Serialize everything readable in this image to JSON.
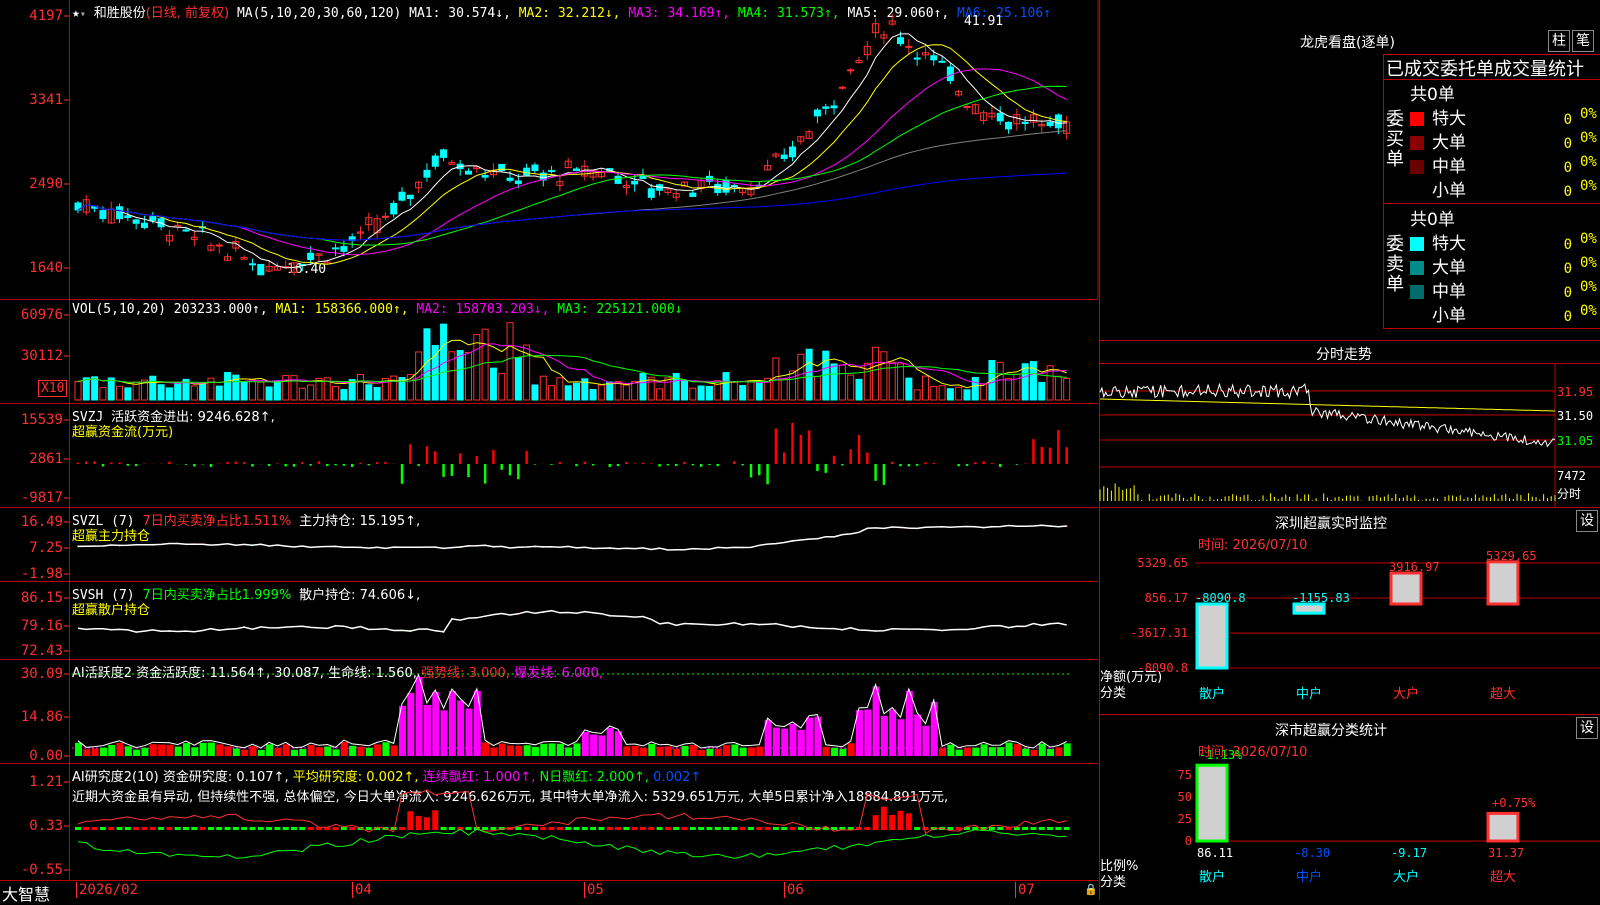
{
  "colors": {
    "up": "#ff3030",
    "down": "#00ffff",
    "grid": "#c00000",
    "ma1": "#ffffff",
    "ma2": "#ffff00",
    "ma3": "#ff00ff",
    "ma4": "#00ff00",
    "ma5": "#808080",
    "ma6": "#0000ff"
  },
  "kline": {
    "stock": "和胜股份",
    "mode": "(日线, 前复权)",
    "ma_header": "MA(5,10,20,30,60,120)",
    "ma1": "MA1: 30.574↓,",
    "ma2": "MA2: 32.212↓,",
    "ma3": "MA3: 34.169↑,",
    "ma4": "MA4: 31.573↑,",
    "ma5": "MA5: 29.060↑,",
    "ma6": "MA6: 25.106↑",
    "high_label": "41.91",
    "low_label": "16.40",
    "y_labels": [
      "4197",
      "3341",
      "2490",
      "1640"
    ]
  },
  "vol": {
    "header": "VOL(5,10,20)",
    "value": "203233.000↑,",
    "ma1": "MA1: 158366.000↑,",
    "ma2": "MA2: 158703.203↓,",
    "ma3": "MA3: 225121.000↓",
    "y_labels": [
      "60976",
      "30112"
    ],
    "unit": "X10"
  },
  "svzj": {
    "header": "SVZJ",
    "value": "活跃资金进出: 9246.628↑,",
    "title": "超赢资金流(万元)",
    "y_labels": [
      "15539",
      "2861",
      "-9817"
    ]
  },
  "svzl": {
    "header": "SVZL (7)",
    "ratio": "7日内买卖净占比1.511%",
    "value": "主力持仓: 15.195↑,",
    "title": "超赢主力持仓",
    "y_labels": [
      "16.49",
      "7.25",
      "-1.98"
    ]
  },
  "svsh": {
    "header": "SVSH (7)",
    "ratio": "7日内买卖净占比1.999%",
    "value": "散户持仓: 74.606↓,",
    "title": "超赢散户持仓",
    "y_labels": [
      "86.15",
      "79.16",
      "72.43"
    ]
  },
  "ai_active": {
    "header": "AI活跃度2",
    "v1": "资金活跃度: 11.564↑, 30.087,",
    "v2": "生命线: 1.560,",
    "v3": "强势线: 3.000,",
    "v4": "爆发线: 6.000,",
    "y_labels": [
      "30.09",
      "14.86",
      "0.00"
    ]
  },
  "ai_research": {
    "header": "AI研究度2(10)",
    "v1": "资金研究度: 0.107↑,",
    "v2": "平均研究度: 0.002↑,",
    "v3": "连续飘红: 1.000↑,",
    "v4": "N日飘红: 2.000↑,",
    "v5": "0.002↑",
    "comment": "近期大资金虽有异动, 但持续性不强, 总体偏空, 今日大单净流入: 9246.626万元, 其中特大单净流入: 5329.651万元, 大单5日累计净入18884.891万元,",
    "y_labels": [
      "1.21",
      "0.33",
      "-0.55"
    ]
  },
  "xaxis": {
    "brand": "大智慧",
    "labels": [
      "2026/02",
      "04",
      "05",
      "06",
      "07"
    ]
  },
  "right_panel": {
    "title": "龙虎看盘(逐单)",
    "btn_bar": "柱",
    "btn_pen": "笔",
    "tabs": [
      "已成交委托单",
      "成交量统计"
    ],
    "buy_label": "委买单",
    "sell_label": "委卖单",
    "buy_total": "共0单",
    "sell_total": "共0单",
    "rows": [
      {
        "name": "特大",
        "count": "0",
        "pct": "0%"
      },
      {
        "name": "大单",
        "count": "0",
        "pct": "0%"
      },
      {
        "name": "中单",
        "count": "0",
        "pct": "0%"
      },
      {
        "name": "小单",
        "count": "0",
        "pct": "0%"
      }
    ],
    "timeshare_title": "分时走势",
    "ts_labels": [
      "31.95",
      "31.50",
      "31.05"
    ],
    "ts_vol": "7472",
    "ts_unit": "分时",
    "monitor_title": "深圳超赢实时监控",
    "monitor_btn": "设",
    "monitor_time": "时间: 2026/07/10",
    "monitor_y": [
      "5329.65",
      "856.17",
      "-3617.31",
      "-8090.8"
    ],
    "monitor_values": [
      "-8090.8",
      "-1155.83",
      "3916.97",
      "5329.65"
    ],
    "monitor_axis_title": "净额(万元)",
    "monitor_cat_title": "分类",
    "categories": [
      "散户",
      "中户",
      "大户",
      "超大"
    ],
    "class_title": "深市超赢分类统计",
    "class_btn": "设",
    "class_time": "时间: 2026/07/10",
    "class_y": [
      "75",
      "50",
      "25",
      "0"
    ],
    "class_top": [
      "-1.13%",
      "+0.75%"
    ],
    "class_values": [
      "86.11",
      "-8.30",
      "-9.17",
      "31.37"
    ],
    "class_axis_title": "比例%",
    "class_cat_title": "分类"
  }
}
